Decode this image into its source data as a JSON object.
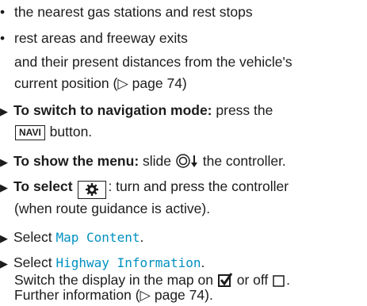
{
  "lines": {
    "b1": "the nearest gas stations and rest stops",
    "b2": "rest areas and freeway exits",
    "c1": "and their present distances from the vehicle's",
    "c2a": "current position (",
    "c2b": " page 74)",
    "s1_bold": "To switch to navigation mode:",
    "s1_text": " press the",
    "s1_key": "NAVI",
    "s1_end": " button.",
    "s2_bold": "To show the menu:",
    "s2_text": " slide ",
    "s2_end": " the controller.",
    "s3_bold": "To select ",
    "s3_text": ": turn and press the controller",
    "s3_line2": "(when route guidance is active).",
    "s4_text": "Select ",
    "s4_menu": "Map Content",
    "s4_end": ".",
    "s5_text": "Select ",
    "s5_menu": "Highway Information",
    "s5_end": ".",
    "s5_line2a": "Switch the display in the map on ",
    "s5_line2b": " or off ",
    "s5_line2c": ".",
    "s5_line3a": "Further information (",
    "s5_line3b": " page 74)."
  },
  "glyphs": {
    "bullet": "•",
    "arrow": "▶",
    "page_ref_icon": "▷"
  },
  "colors": {
    "menu_text": "#0090c0",
    "text": "#1c1c1c"
  }
}
